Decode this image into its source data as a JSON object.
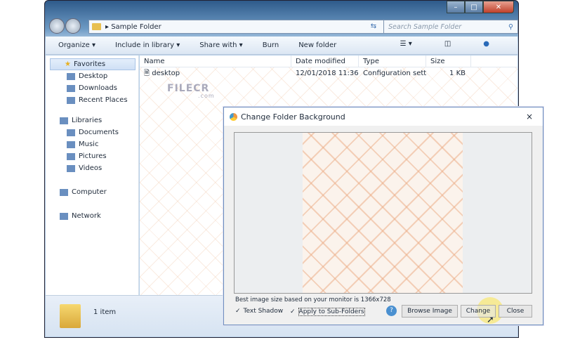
{
  "window": {
    "address": "Sample Folder",
    "search_placeholder": "Search Sample Folder"
  },
  "toolbar": {
    "organize": "Organize ▾",
    "include": "Include in library ▾",
    "share": "Share with ▾",
    "burn": "Burn",
    "new_folder": "New folder"
  },
  "sidebar": {
    "favorites": "Favorites",
    "fav_items": [
      "Desktop",
      "Downloads",
      "Recent Places"
    ],
    "libraries": "Libraries",
    "lib_items": [
      "Documents",
      "Music",
      "Pictures",
      "Videos"
    ],
    "computer": "Computer",
    "network": "Network"
  },
  "columns": {
    "name": "Name",
    "date": "Date modified",
    "type": "Type",
    "size": "Size"
  },
  "files": [
    {
      "name": "desktop",
      "date": "12/01/2018 11:36",
      "type": "Configuration sett...",
      "size": "1 KB"
    }
  ],
  "status": {
    "count": "1 item"
  },
  "watermark": {
    "text": "FILECR",
    "sub": ".com"
  },
  "dialog": {
    "title": "Change Folder Background",
    "hint": "Best image size based on your monitor is 1366x728",
    "text_shadow": "Text Shadow",
    "apply_sub": "Apply to Sub-Folders",
    "browse": "Browse Image",
    "change": "Change",
    "close": "Close",
    "help": "?",
    "close_x": "×"
  }
}
